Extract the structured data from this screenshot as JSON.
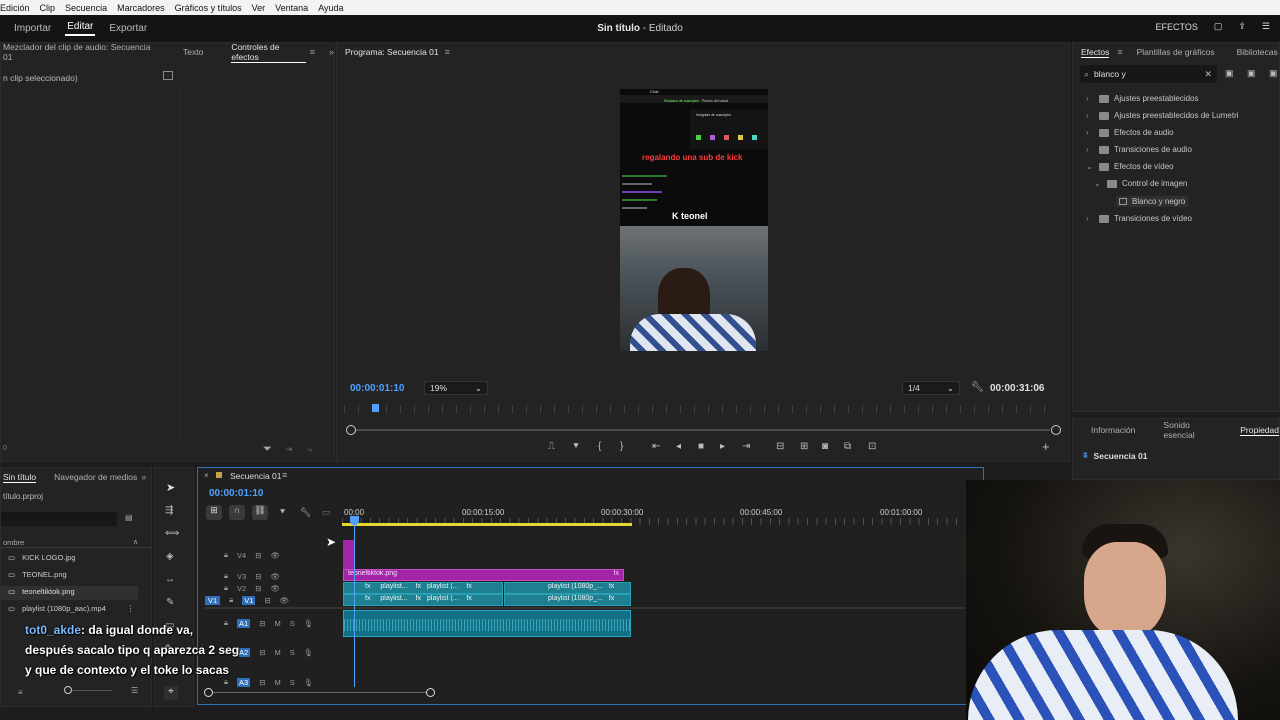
{
  "menubar": {
    "items": [
      "Edición",
      "Clip",
      "Secuencia",
      "Marcadores",
      "Gráficos y títulos",
      "Ver",
      "Ventana",
      "Ayuda"
    ]
  },
  "header": {
    "tabs": [
      "Importar",
      "Editar",
      "Exportar"
    ],
    "title_name": "Sin título",
    "title_state": "- Editado",
    "efectos_label": "EFECTOS"
  },
  "left_panel": {
    "tabs": [
      "Mezclador del clip de audio: Secuencia 01",
      "Texto",
      "Controles de efectos"
    ],
    "no_clip": "n clip seleccionado)",
    "counter": "0"
  },
  "program": {
    "title": "Programa: Secuencia 01",
    "timecode": "00:00:01:10",
    "zoom": "19%",
    "resolution": "1/4",
    "duration": "00:00:31:06",
    "overlay_text": "regalando una sub de kick",
    "brand": "teonel",
    "chat_label": "Chat",
    "header_line": "Insígnias de suscriptor",
    "top_labels": [
      "Kickazos de suscriptor",
      "Puntos del canal"
    ]
  },
  "effects_panel": {
    "tabs": [
      "Efectos",
      "Plantillas de gráficos",
      "Bibliotecas"
    ],
    "search_value": "blanco y",
    "tree": [
      {
        "label": "Ajustes preestablecidos",
        "level": 0,
        "expanded": false
      },
      {
        "label": "Ajustes preestablecidos de Lumetri",
        "level": 0,
        "expanded": false
      },
      {
        "label": "Efectos de audio",
        "level": 0,
        "expanded": false
      },
      {
        "label": "Transiciones de audio",
        "level": 0,
        "expanded": false
      },
      {
        "label": "Efectos de vídeo",
        "level": 0,
        "expanded": true
      },
      {
        "label": "Control de imagen",
        "level": 1,
        "expanded": true
      },
      {
        "label": "Blanco y negro",
        "level": 2,
        "expanded": false
      },
      {
        "label": "Transiciones de vídeo",
        "level": 0,
        "expanded": false
      }
    ]
  },
  "props_panel": {
    "tabs": [
      "Información",
      "Sonido esencial",
      "Propiedad"
    ],
    "sequence": "Secuencia 01"
  },
  "project_panel": {
    "tabs": [
      "Sin título",
      "Navegador de medios"
    ],
    "project_file": "título.prproj",
    "column": "ombre",
    "files": [
      "KICK LOGO.jpg",
      "TEONEL.png",
      "teoneltiktok.png",
      "playlist (1080p_aac).mp4"
    ]
  },
  "timeline": {
    "tab": "Secuencia 01",
    "timecode": "00:00:01:10",
    "ruler": [
      "00:00",
      "00:00:15:00",
      "00:00:30:00",
      "00:00:45:00",
      "00:01:00:00"
    ],
    "video_tracks": [
      "V4",
      "V3",
      "V2",
      "V1"
    ],
    "audio_tracks": [
      "A1",
      "A2",
      "A3"
    ],
    "source_patch": "V1",
    "pink_clip": "teoneltiktok.png",
    "v2_clips": [
      "playlist...",
      "playlist (...",
      "playlist (1080p_..."
    ],
    "v1_clips": [
      "playlist...",
      "playlist (...",
      "playlist (1080p_..."
    ],
    "fx": "fx",
    "m": "M",
    "s": "S"
  },
  "chat": {
    "user": "tot0_akde",
    "text": ": da igual donde va, después sacalo tipo q aparezca 2 seg y que de contexto y el toke lo sacas"
  },
  "colors": {
    "accent": "#4ea1ff",
    "clip_blue": "#1d7f8f",
    "clip_pink": "#a325a7",
    "playhead": "#4ea1ff",
    "work_area": "#e6d832"
  }
}
